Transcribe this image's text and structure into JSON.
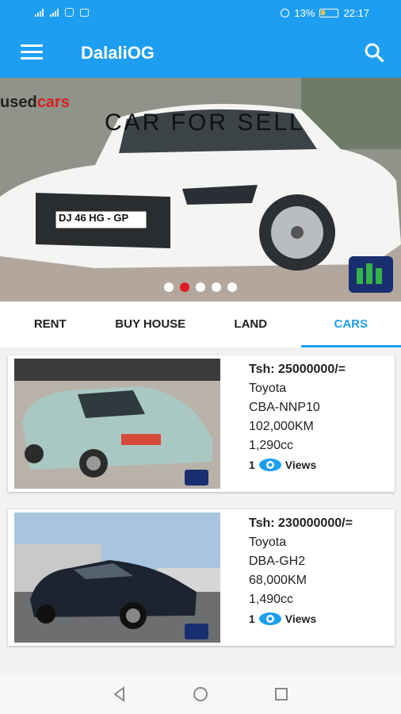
{
  "status": {
    "battery": "13%",
    "time": "22:17"
  },
  "app": {
    "title": "DalaliOG"
  },
  "banner": {
    "logo_left": "used",
    "logo_right": "cars",
    "title": "CAR FOR SELL",
    "plate": "DJ 46 HG - GP",
    "slides": 5,
    "active_slide": 2
  },
  "tabs": [
    {
      "label": "RENT"
    },
    {
      "label": "BUY HOUSE"
    },
    {
      "label": "LAND"
    },
    {
      "label": "CARS"
    }
  ],
  "active_tab": "CARS",
  "listings": [
    {
      "price": "Tsh: 25000000/=",
      "make": "Toyota",
      "model": "CBA-NNP10",
      "mileage": "102,000KM",
      "engine": "1,290cc",
      "views": "1",
      "views_label": "Views"
    },
    {
      "price": "Tsh: 230000000/=",
      "make": "Toyota",
      "model": "DBA-GH2",
      "mileage": "68,000KM",
      "engine": "1,490cc",
      "views": "1",
      "views_label": "Views"
    }
  ],
  "colors": {
    "primary": "#1e9ef0",
    "accent": "#e01b22"
  }
}
